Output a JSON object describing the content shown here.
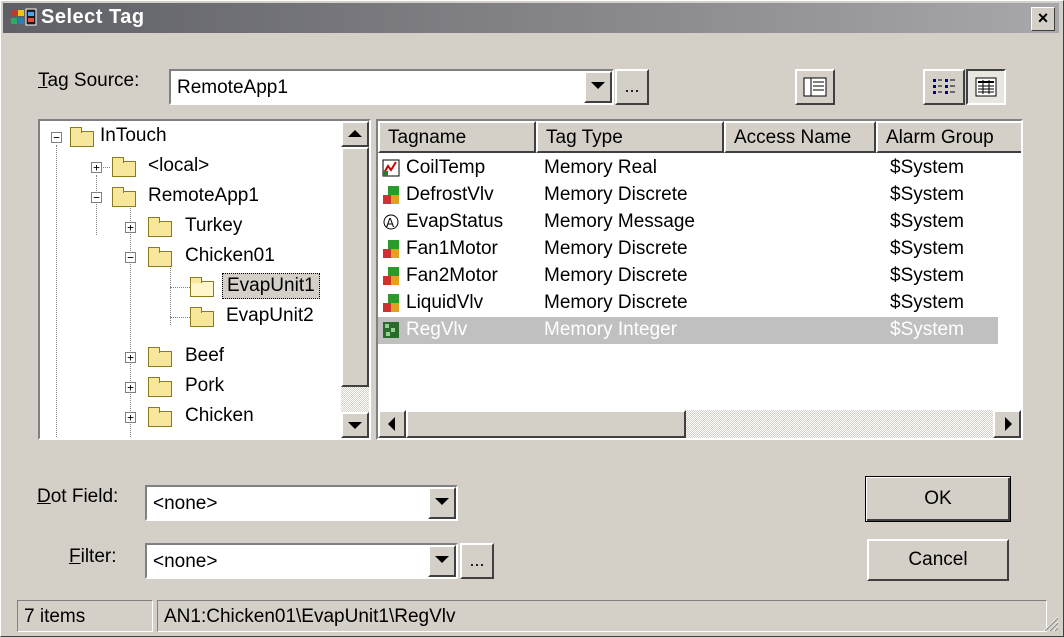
{
  "window": {
    "title": "Select Tag",
    "close_glyph": "×"
  },
  "tag_source": {
    "label_prefix": "T",
    "label_rest": "ag Source:",
    "value": "RemoteApp1",
    "browse": "..."
  },
  "tree": {
    "items": [
      {
        "label": "InTouch"
      },
      {
        "label": "<local>"
      },
      {
        "label": "RemoteApp1"
      },
      {
        "label": "Turkey"
      },
      {
        "label": "Chicken01"
      },
      {
        "label": "EvapUnit1"
      },
      {
        "label": "EvapUnit2"
      },
      {
        "label": "Beef"
      },
      {
        "label": "Pork"
      },
      {
        "label": "Chicken"
      }
    ]
  },
  "list": {
    "columns": [
      "Tagname",
      "Tag Type",
      "Access Name",
      "Alarm Group"
    ],
    "rows": [
      {
        "tagname": "CoilTemp",
        "type": "Memory Real",
        "access": "",
        "group": "$System"
      },
      {
        "tagname": "DefrostVlv",
        "type": "Memory Discrete",
        "access": "",
        "group": "$System"
      },
      {
        "tagname": "EvapStatus",
        "type": "Memory Message",
        "access": "",
        "group": "$System"
      },
      {
        "tagname": "Fan1Motor",
        "type": "Memory Discrete",
        "access": "",
        "group": "$System"
      },
      {
        "tagname": "Fan2Motor",
        "type": "Memory Discrete",
        "access": "",
        "group": "$System"
      },
      {
        "tagname": "LiquidVlv",
        "type": "Memory Discrete",
        "access": "",
        "group": "$System"
      },
      {
        "tagname": "RegVlv",
        "type": "Memory Integer",
        "access": "",
        "group": "$System"
      }
    ]
  },
  "dot_field": {
    "label_prefix": "D",
    "label_rest": "ot Field:",
    "value": "<none>"
  },
  "filter": {
    "label_prefix": "F",
    "label_rest": "ilter:",
    "value": "<none>",
    "browse": "..."
  },
  "buttons": {
    "ok": "OK",
    "cancel": "Cancel"
  },
  "status": {
    "count": "7 items",
    "path": "AN1:Chicken01\\EvapUnit1\\RegVlv"
  },
  "colors": {
    "selection": "#c0c0c0",
    "selected_text": "#ffffff"
  }
}
